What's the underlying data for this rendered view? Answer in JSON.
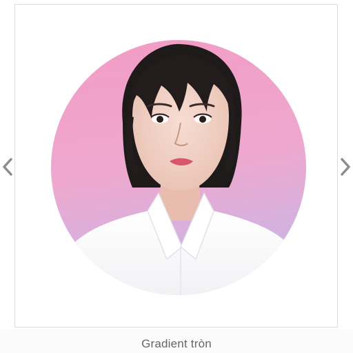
{
  "gallery": {
    "caption": "Gradient tròn",
    "prev_icon": "chevron-left-icon",
    "next_icon": "chevron-right-icon",
    "arrow_color": "#8c8c8c",
    "background_gradient": [
      "#f29cc4",
      "#eea8cf",
      "#c9b6e6"
    ],
    "shirt_color": "#ffffff",
    "hair_color": "#1f1a1a"
  }
}
